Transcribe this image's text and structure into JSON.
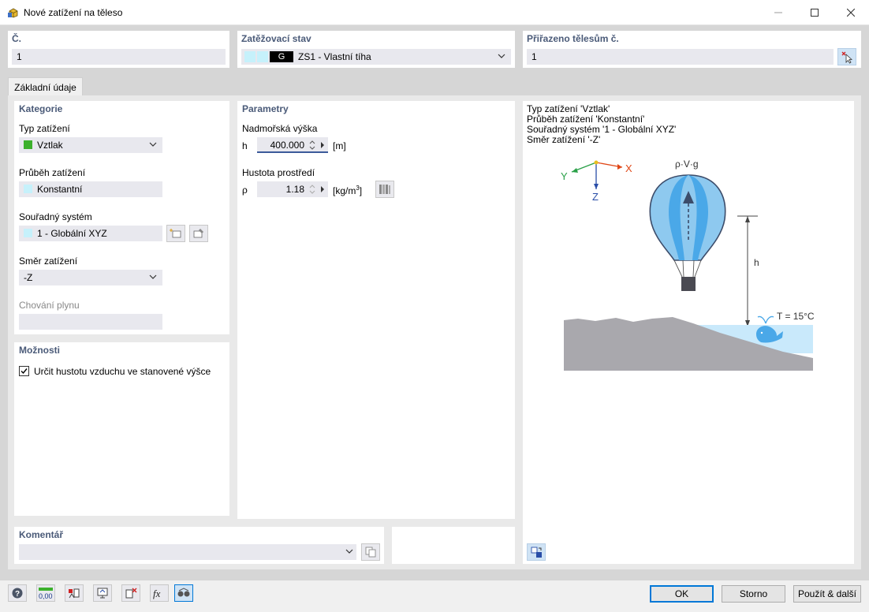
{
  "window": {
    "title": "Nové zatížení na těleso"
  },
  "top": {
    "number_label": "Č.",
    "number_value": "1",
    "load_case_label": "Zatěžovací stav",
    "load_case_badge": "G",
    "load_case_value": "ZS1 - Vlastní tíha",
    "assigned_label": "Přiřazeno tělesům č.",
    "assigned_value": "1"
  },
  "tabs": [
    {
      "label": "Základní údaje"
    }
  ],
  "category": {
    "title": "Kategorie",
    "load_type_label": "Typ zatížení",
    "load_type_value": "Vztlak",
    "load_type_color": "#3cb02c",
    "distribution_label": "Průběh zatížení",
    "distribution_value": "Konstantní",
    "coord_label": "Souřadný systém",
    "coord_value": "1 - Globální XYZ",
    "direction_label": "Směr zatížení",
    "direction_value": "-Z",
    "gas_label": "Chování plynu",
    "gas_value": ""
  },
  "options": {
    "title": "Možnosti",
    "checkbox_label": "Určit hustotu vzduchu ve stanovené výšce",
    "checked": true
  },
  "params": {
    "title": "Parametry",
    "altitude_label": "Nadmořská výška",
    "altitude_symbol": "h",
    "altitude_value": "400.000",
    "altitude_unit": "[m]",
    "density_label": "Hustota prostředí",
    "density_symbol": "ρ",
    "density_value": "1.18",
    "density_unit_main": "[kg/m",
    "density_unit_sup": "3",
    "density_unit_end": "]"
  },
  "info": {
    "lines": [
      "Typ zatížení 'Vztlak'",
      "Průběh zatížení 'Konstantní'",
      "Souřadný systém '1 - Globální XYZ'",
      "Směr zatížení '-Z'"
    ],
    "formula": "ρ·V·g",
    "h_label": "h",
    "temp_label": "T = 15°C",
    "axis_x": "X",
    "axis_y": "Y",
    "axis_z": "Z"
  },
  "comment": {
    "title": "Komentář",
    "value": ""
  },
  "buttons": {
    "ok": "OK",
    "cancel": "Storno",
    "apply_next": "Použít & další"
  },
  "colors": {
    "accent": "#0078d7",
    "section_label": "#4a5a78",
    "balloon_light": "#8ec9ef",
    "balloon_mid": "#4aa8e8",
    "ground": "#a9a8ad",
    "water": "#c9e9fb",
    "swatch_cyan": "#c6f1fb"
  }
}
